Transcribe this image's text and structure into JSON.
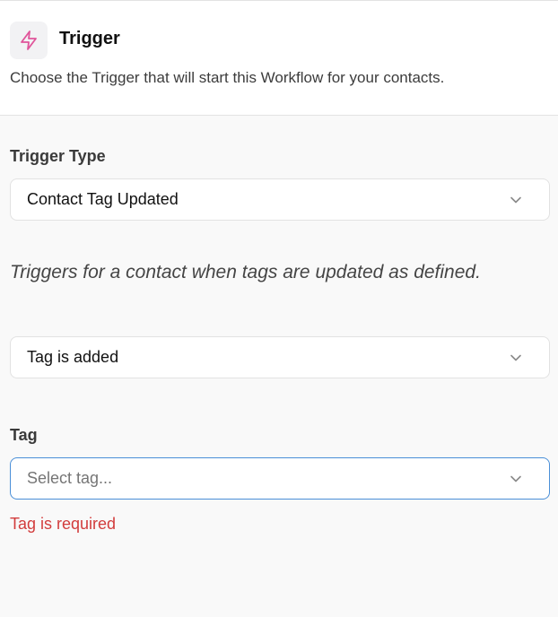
{
  "header": {
    "icon": "lightning-bolt-icon",
    "icon_color": "#e0549a",
    "title": "Trigger",
    "subtitle": "Choose the Trigger that will start this Workflow for your contacts."
  },
  "trigger_type": {
    "label": "Trigger Type",
    "selected": "Contact Tag Updated"
  },
  "description": "Triggers for a contact when tags are updated as defined.",
  "tag_action": {
    "selected": "Tag is added"
  },
  "tag": {
    "label": "Tag",
    "placeholder": "Select tag...",
    "error": "Tag is required",
    "error_color": "#d23c3c",
    "focus_color": "#4a8fd8"
  }
}
